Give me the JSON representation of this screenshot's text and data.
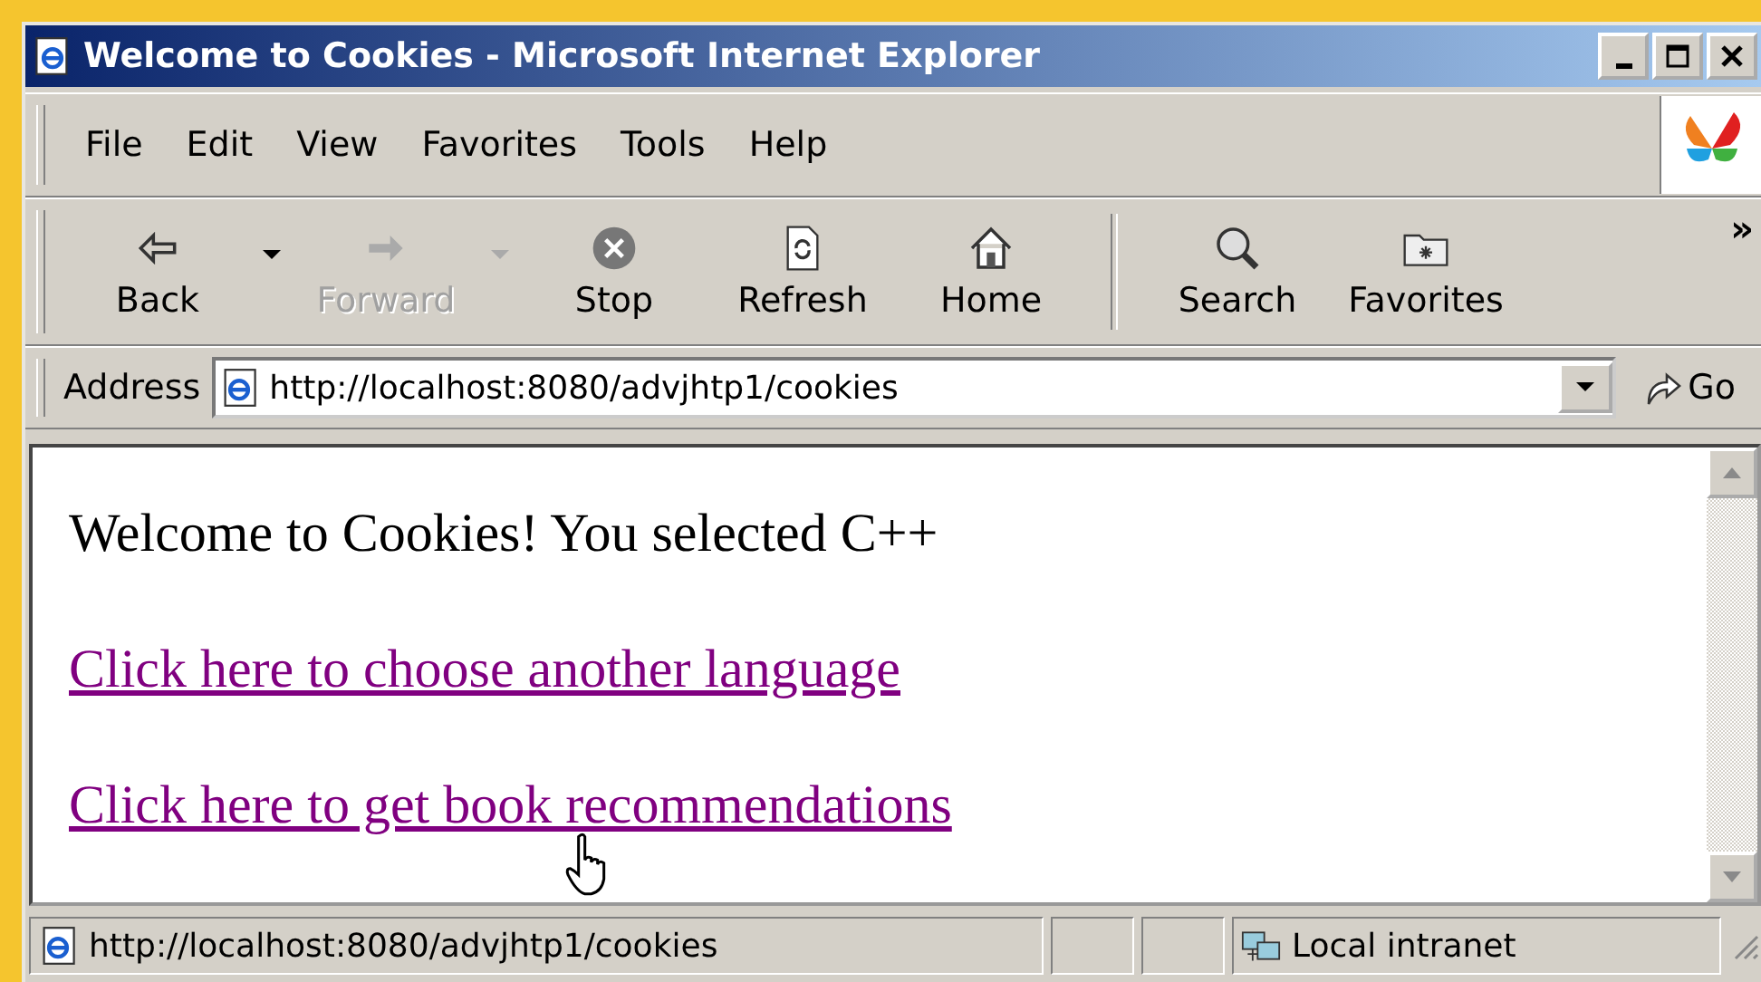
{
  "window": {
    "title": "Welcome to Cookies - Microsoft Internet Explorer"
  },
  "menu": [
    "File",
    "Edit",
    "View",
    "Favorites",
    "Tools",
    "Help"
  ],
  "toolbar": [
    {
      "label": "Back",
      "disabled": false,
      "dropdown": true
    },
    {
      "label": "Forward",
      "disabled": true,
      "dropdown": true
    },
    {
      "label": "Stop",
      "disabled": false,
      "dropdown": false
    },
    {
      "label": "Refresh",
      "disabled": false,
      "dropdown": false
    },
    {
      "label": "Home",
      "disabled": false,
      "dropdown": false
    },
    {
      "label": "Search",
      "disabled": false,
      "dropdown": false
    },
    {
      "label": "Favorites",
      "disabled": false,
      "dropdown": false
    }
  ],
  "toolbar_more": "»",
  "address": {
    "label": "Address",
    "value": "http://localhost:8080/advjhtp1/cookies",
    "go": "Go"
  },
  "content": {
    "text": "Welcome to Cookies! You selected C++",
    "links": [
      "Click here to choose another language",
      "Click here to get book recommendations"
    ]
  },
  "status_bar": {
    "url": "http://localhost:8080/advjhtp1/cookies",
    "zone": "Local intranet"
  }
}
